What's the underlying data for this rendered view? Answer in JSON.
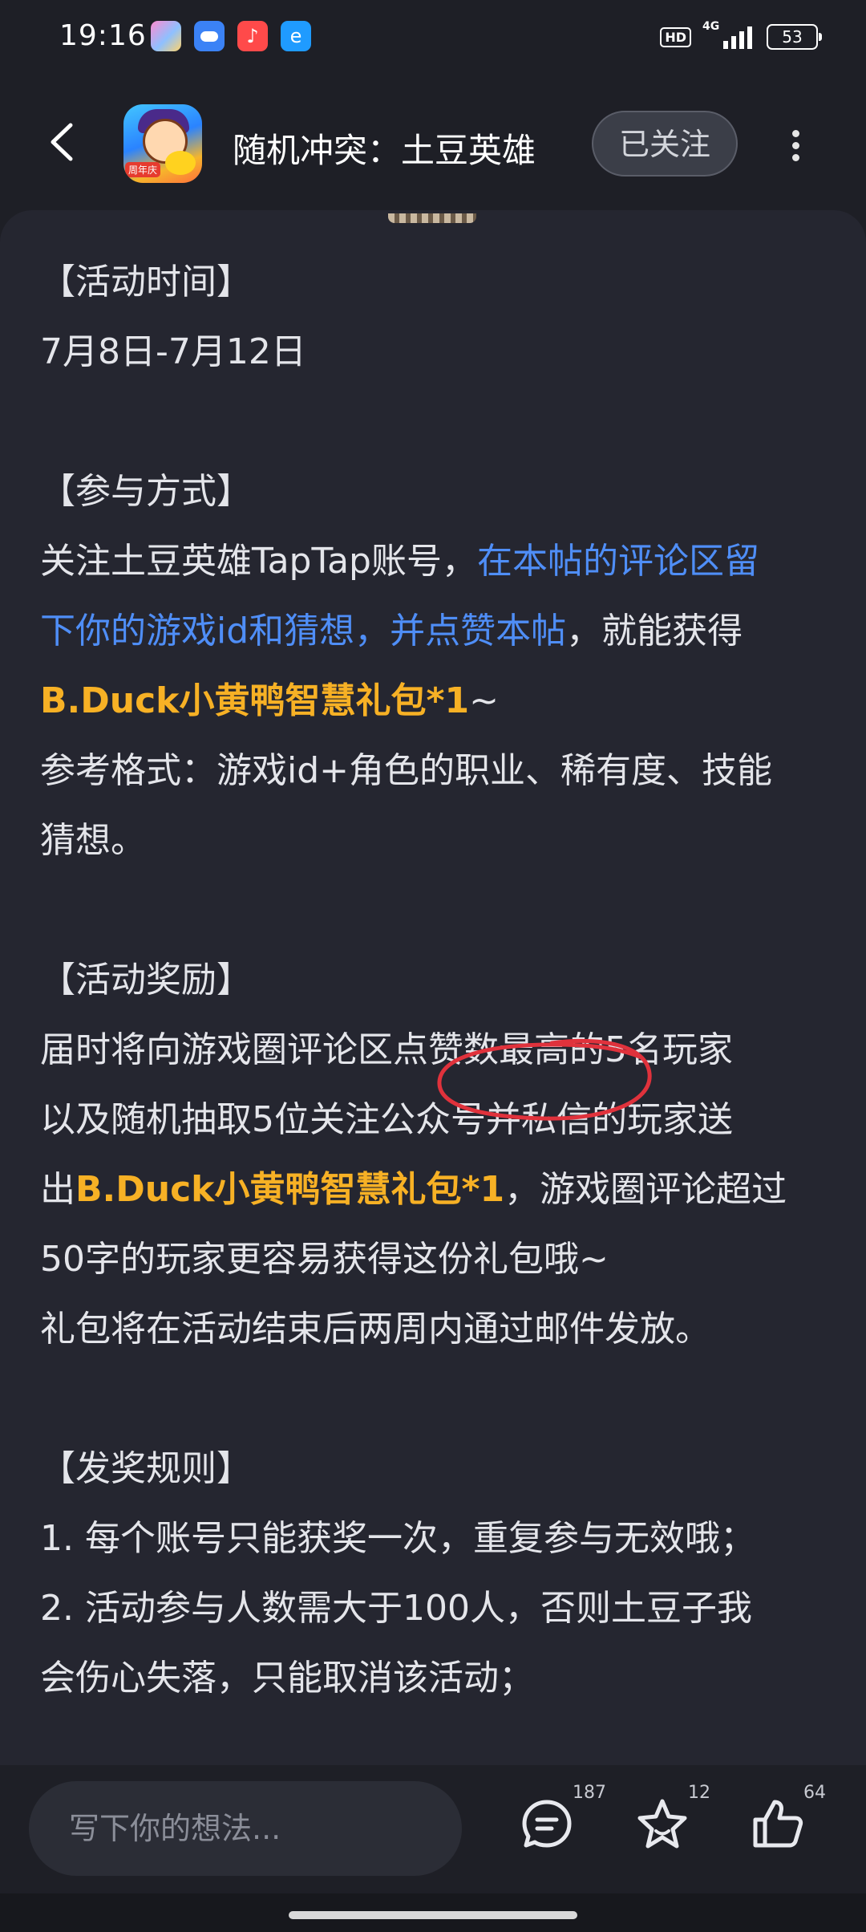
{
  "status_bar": {
    "time": "19:16",
    "hd": "HD",
    "network": "4G",
    "battery": "53",
    "app_icons": [
      "photo-app-icon",
      "weather-icon",
      "music-icon",
      "browser-icon"
    ]
  },
  "header": {
    "back_icon": "chevron-left-icon",
    "title": "随机冲突：土豆英雄",
    "follow_label": "已关注",
    "more_icon": "more-vertical-icon",
    "app_icon_tag": "周年庆"
  },
  "post": {
    "time_heading": "【活动时间】",
    "time_value": "7月8日-7月12日",
    "method_heading": "【参与方式】",
    "method_text_1": "关注土豆英雄TapTap账号，",
    "method_blue_1": "在本帖的评论区留",
    "method_blue_2": "下你的游戏id和猜想，并点赞本帖",
    "method_text_2": "，就能获得",
    "method_gold": "B.Duck小黄鸭智慧礼包*1",
    "method_tilde": "~",
    "format_line_1": "参考格式：游戏id+角色的职业、稀有度、技能",
    "format_line_2": "猜想。",
    "reward_heading": "【活动奖励】",
    "reward_line_1": "届时将向游戏圈评论区点赞数最高的5名玩家",
    "reward_line_2": "以及随机抽取5位关注公众号并私信的玩家送",
    "reward_line_3_pre": "出",
    "reward_line_3_gold": "B.Duck小黄鸭智慧礼包*1",
    "reward_line_3_post": "，游戏圈评论超过",
    "reward_line_4": "50字的玩家更容易获得这份礼包哦~",
    "reward_line_5": "礼包将在活动结束后两周内通过邮件发放。",
    "rules_heading": "【发奖规则】",
    "rule_1": "1. 每个账号只能获奖一次，重复参与无效哦；",
    "rule_2a": "2. 活动参与人数需大于100人，否则土豆子我",
    "rule_2b": "会伤心失落，只能取消该活动；"
  },
  "bottom_bar": {
    "input_placeholder": "写下你的想法...",
    "comment_count": "187",
    "favorite_count": "12",
    "like_count": "64"
  },
  "colors": {
    "background": "#1e1f26",
    "card": "#252630",
    "link_blue": "#4f8ef7",
    "highlight_gold": "#f7b125",
    "annotation_red": "#e0323c"
  }
}
